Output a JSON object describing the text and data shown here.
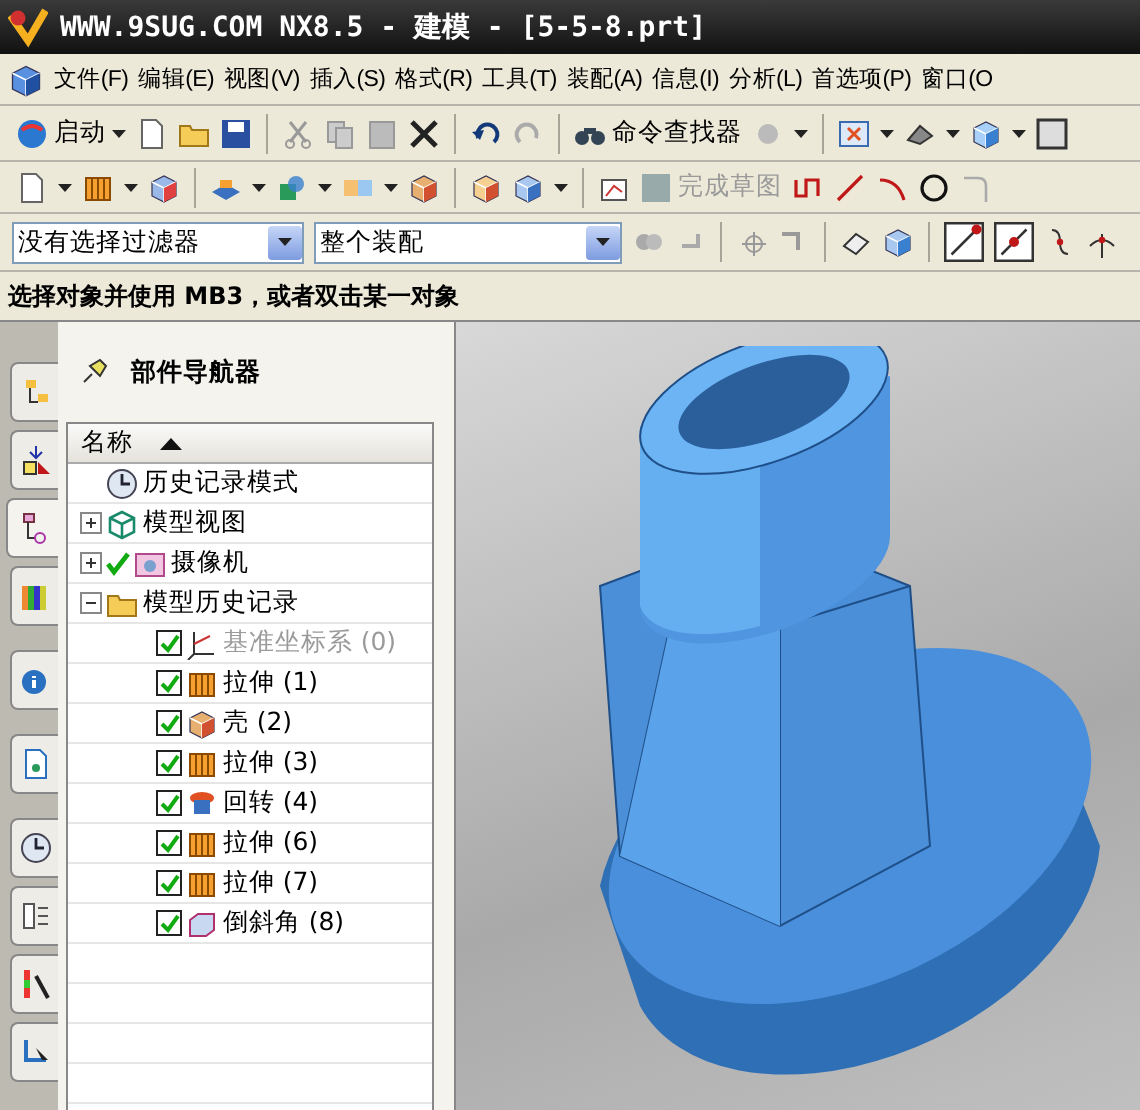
{
  "window": {
    "title": "WWW.9SUG.COM NX8.5 - 建模 - [5-5-8.prt]"
  },
  "menu": [
    "文件(F)",
    "编辑(E)",
    "视图(V)",
    "插入(S)",
    "格式(R)",
    "工具(T)",
    "装配(A)",
    "信息(I)",
    "分析(L)",
    "首选项(P)",
    "窗口(O"
  ],
  "rail_tabs": [
    {
      "selected": false
    },
    {
      "selected": false
    },
    {
      "selected": true
    },
    {
      "selected": false
    },
    {
      "selected": false
    },
    {
      "selected": false
    },
    {
      "selected": false
    },
    {
      "selected": false
    },
    {
      "selected": false
    },
    {
      "selected": false
    }
  ],
  "toolbar": {
    "start_label": "启动",
    "command_finder_label": "命令查找器",
    "finish_sketch": {
      "label": "完成草图",
      "disabled": true
    }
  },
  "selection_bar": {
    "type_filter": "没有选择过滤器",
    "scope": "整个装配"
  },
  "prompt": "选择对象并使用 MB3，或者双击某一对象",
  "navigator": {
    "title": "部件导航器",
    "column": "名称",
    "tree": [
      {
        "label": "历史记录模式",
        "kind": "clock"
      },
      {
        "label": "模型视图",
        "kind": "view",
        "expanded": false
      },
      {
        "label": "摄像机",
        "kind": "camera",
        "expanded": false,
        "checked": true
      },
      {
        "label": "模型历史记录",
        "kind": "folder",
        "expanded": true,
        "children": [
          {
            "label": "基准坐标系 (0)",
            "kind": "csys",
            "checked": true,
            "disabled": true
          },
          {
            "label": "拉伸 (1)",
            "kind": "extrude",
            "checked": true,
            "disabled": false
          },
          {
            "label": "壳 (2)",
            "kind": "shell",
            "checked": true,
            "disabled": false
          },
          {
            "label": "拉伸 (3)",
            "kind": "extrude",
            "checked": true,
            "disabled": false
          },
          {
            "label": "回转 (4)",
            "kind": "revolve",
            "checked": true,
            "disabled": false
          },
          {
            "label": "拉伸 (6)",
            "kind": "extrude",
            "checked": true,
            "disabled": false
          },
          {
            "label": "拉伸 (7)",
            "kind": "extrude",
            "checked": true,
            "disabled": false
          },
          {
            "label": "倒斜角 (8)",
            "kind": "chamfer",
            "checked": true,
            "disabled": false
          }
        ]
      }
    ]
  }
}
